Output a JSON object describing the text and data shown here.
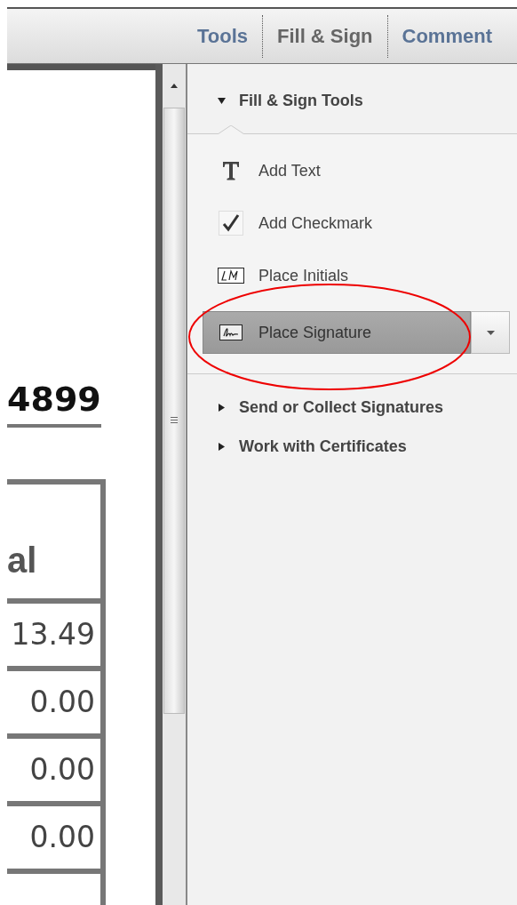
{
  "toolbar": {
    "tabs": [
      {
        "label": "Tools",
        "selected": false
      },
      {
        "label": "Fill & Sign",
        "selected": true
      },
      {
        "label": "Comment",
        "selected": false
      }
    ]
  },
  "document": {
    "number": "4899",
    "table": {
      "header": "al",
      "rows": [
        "13.49",
        "0.00",
        "0.00",
        "0.00"
      ]
    }
  },
  "panel": {
    "sections": [
      {
        "title": "Fill & Sign Tools",
        "expanded": true,
        "tools": [
          {
            "kind": "text",
            "label": "Add Text",
            "selected": false
          },
          {
            "kind": "checkmark",
            "label": "Add Checkmark",
            "selected": false
          },
          {
            "kind": "initials",
            "label": "Place Initials",
            "selected": false
          },
          {
            "kind": "signature",
            "label": "Place Signature",
            "selected": true
          }
        ]
      },
      {
        "title": "Send or Collect Signatures",
        "expanded": false
      },
      {
        "title": "Work with Certificates",
        "expanded": false
      }
    ]
  }
}
